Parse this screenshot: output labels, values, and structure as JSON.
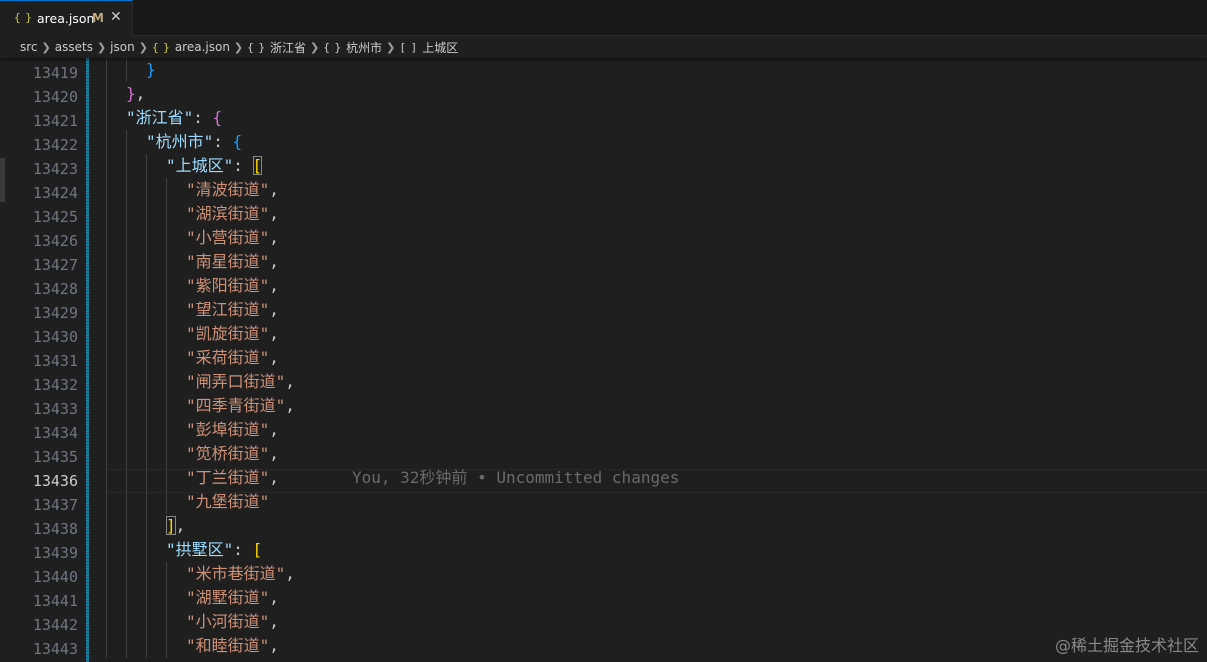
{
  "tab": {
    "icon": "{ }",
    "filename": "area.json",
    "status": "M",
    "close": "✕"
  },
  "breadcrumb": {
    "items": [
      "src",
      "assets",
      "json",
      "area.json",
      "浙江省",
      "杭州市",
      "上城区"
    ],
    "icons": [
      "",
      "",
      "",
      "{ }",
      "{ }",
      "{ }",
      "[ ]"
    ],
    "separator": "❯"
  },
  "editor": {
    "current_line": "13436",
    "line_numbers": [
      "13419",
      "13420",
      "13421",
      "13422",
      "13423",
      "13424",
      "13425",
      "13426",
      "13427",
      "13428",
      "13429",
      "13430",
      "13431",
      "13432",
      "13433",
      "13434",
      "13435",
      "13436",
      "13437",
      "13438",
      "13439",
      "13440",
      "13441",
      "13442",
      "13443"
    ],
    "blame": "You, 32秒钟前 • Uncommitted changes",
    "lines": [
      {
        "indent": 2,
        "tokens": [
          {
            "t": "}",
            "c": "b3"
          }
        ]
      },
      {
        "indent": 1,
        "tokens": [
          {
            "t": "}",
            "c": "b2"
          },
          {
            "t": ",",
            "c": "p"
          }
        ]
      },
      {
        "indent": 1,
        "tokens": [
          {
            "t": "\"浙江省\"",
            "c": "k"
          },
          {
            "t": ": ",
            "c": "p"
          },
          {
            "t": "{",
            "c": "b2"
          }
        ]
      },
      {
        "indent": 2,
        "tokens": [
          {
            "t": "\"杭州市\"",
            "c": "k"
          },
          {
            "t": ": ",
            "c": "p"
          },
          {
            "t": "{",
            "c": "b3"
          }
        ]
      },
      {
        "indent": 3,
        "tokens": [
          {
            "t": "\"上城区\"",
            "c": "k"
          },
          {
            "t": ": ",
            "c": "p"
          },
          {
            "t": "[",
            "c": "b1 bm"
          }
        ]
      },
      {
        "indent": 4,
        "tokens": [
          {
            "t": "\"清波街道\"",
            "c": "s"
          },
          {
            "t": ",",
            "c": "p"
          }
        ]
      },
      {
        "indent": 4,
        "tokens": [
          {
            "t": "\"湖滨街道\"",
            "c": "s"
          },
          {
            "t": ",",
            "c": "p"
          }
        ]
      },
      {
        "indent": 4,
        "tokens": [
          {
            "t": "\"小营街道\"",
            "c": "s"
          },
          {
            "t": ",",
            "c": "p"
          }
        ]
      },
      {
        "indent": 4,
        "tokens": [
          {
            "t": "\"南星街道\"",
            "c": "s"
          },
          {
            "t": ",",
            "c": "p"
          }
        ]
      },
      {
        "indent": 4,
        "tokens": [
          {
            "t": "\"紫阳街道\"",
            "c": "s"
          },
          {
            "t": ",",
            "c": "p"
          }
        ]
      },
      {
        "indent": 4,
        "tokens": [
          {
            "t": "\"望江街道\"",
            "c": "s"
          },
          {
            "t": ",",
            "c": "p"
          }
        ]
      },
      {
        "indent": 4,
        "tokens": [
          {
            "t": "\"凯旋街道\"",
            "c": "s"
          },
          {
            "t": ",",
            "c": "p"
          }
        ]
      },
      {
        "indent": 4,
        "tokens": [
          {
            "t": "\"采荷街道\"",
            "c": "s"
          },
          {
            "t": ",",
            "c": "p"
          }
        ]
      },
      {
        "indent": 4,
        "tokens": [
          {
            "t": "\"闸弄口街道\"",
            "c": "s"
          },
          {
            "t": ",",
            "c": "p"
          }
        ]
      },
      {
        "indent": 4,
        "tokens": [
          {
            "t": "\"四季青街道\"",
            "c": "s"
          },
          {
            "t": ",",
            "c": "p"
          }
        ]
      },
      {
        "indent": 4,
        "tokens": [
          {
            "t": "\"彭埠街道\"",
            "c": "s"
          },
          {
            "t": ",",
            "c": "p"
          }
        ]
      },
      {
        "indent": 4,
        "tokens": [
          {
            "t": "\"笕桥街道\"",
            "c": "s"
          },
          {
            "t": ",",
            "c": "p"
          }
        ]
      },
      {
        "indent": 4,
        "tokens": [
          {
            "t": "\"丁兰街道\"",
            "c": "s"
          },
          {
            "t": ",",
            "c": "p"
          }
        ]
      },
      {
        "indent": 4,
        "tokens": [
          {
            "t": "\"九堡街道\"",
            "c": "s"
          }
        ]
      },
      {
        "indent": 3,
        "tokens": [
          {
            "t": "]",
            "c": "b1 bm"
          },
          {
            "t": ",",
            "c": "p"
          }
        ]
      },
      {
        "indent": 3,
        "tokens": [
          {
            "t": "\"拱墅区\"",
            "c": "k"
          },
          {
            "t": ": ",
            "c": "p"
          },
          {
            "t": "[",
            "c": "b1"
          }
        ]
      },
      {
        "indent": 4,
        "tokens": [
          {
            "t": "\"米市巷街道\"",
            "c": "s"
          },
          {
            "t": ",",
            "c": "p"
          }
        ]
      },
      {
        "indent": 4,
        "tokens": [
          {
            "t": "\"湖墅街道\"",
            "c": "s"
          },
          {
            "t": ",",
            "c": "p"
          }
        ]
      },
      {
        "indent": 4,
        "tokens": [
          {
            "t": "\"小河街道\"",
            "c": "s"
          },
          {
            "t": ",",
            "c": "p"
          }
        ]
      },
      {
        "indent": 4,
        "tokens": [
          {
            "t": "\"和睦街道\"",
            "c": "s"
          },
          {
            "t": ",",
            "c": "p"
          }
        ]
      }
    ]
  },
  "watermark": "@稀土掘金技术社区"
}
